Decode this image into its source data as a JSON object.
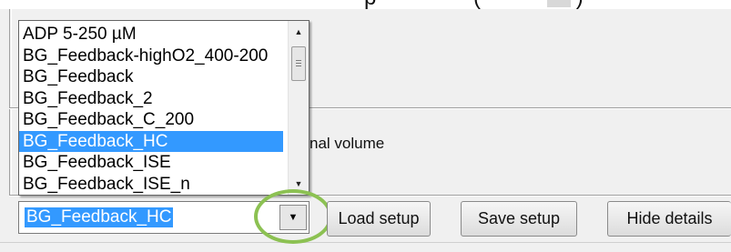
{
  "heading": {
    "partial_text": "p",
    "partial_paren": "(",
    "partial_close": ")"
  },
  "dialog": {
    "partial_label": "nal volume"
  },
  "dropdown": {
    "items": [
      "ADP 5-250 µM",
      "BG_Feedback-highO2_400-200",
      "BG_Feedback",
      "BG_Feedback_2",
      "BG_Feedback_C_200",
      "BG_Feedback_HC",
      "BG_Feedback_ISE",
      "BG_Feedback_ISE_n"
    ],
    "selected_index": 5,
    "selected_value": "BG_Feedback_HC",
    "arrow_glyph": "▼",
    "scroll_up_glyph": "▲",
    "scroll_down_glyph": "▼"
  },
  "buttons": {
    "load": "Load setup",
    "save": "Save setup",
    "hide": "Hide details"
  },
  "colors": {
    "selection": "#3399ff",
    "annotation_circle": "#8cc152"
  }
}
